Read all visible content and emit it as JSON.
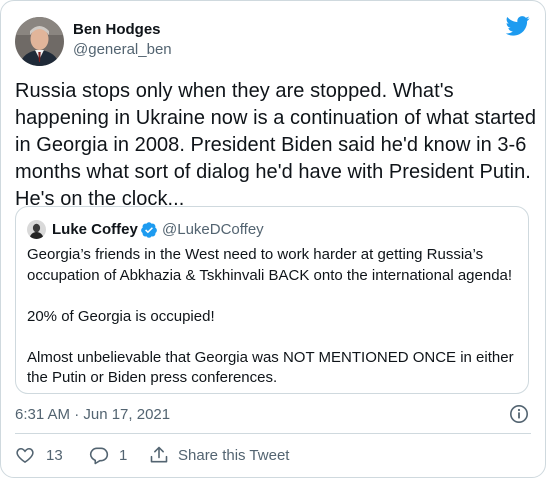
{
  "author": {
    "name": "Ben Hodges",
    "handle": "@general_ben"
  },
  "tweet_text": "Russia stops only when they are stopped.  What's happening in Ukraine now is a continuation of what started in Georgia in 2008. President Biden said he'd know in 3-6 months what sort of dialog he'd have with President Putin.  He's on the clock...",
  "quoted_tweet": {
    "name": "Luke Coffey",
    "handle": "@LukeDCoffey",
    "paragraphs": [
      "Georgia’s friends in the West need to work harder at getting Russia’s occupation of Abkhazia & Tskhinvali BACK onto the international agenda!",
      "20% of Georgia is occupied!",
      "Almost unbelievable that Georgia was NOT MENTIONED ONCE in either the Putin or Biden press conferences."
    ]
  },
  "timestamp": "6:31 AM · Jun 17, 2021",
  "actions": {
    "like_count": "13",
    "reply_count": "1",
    "share_label": "Share this Tweet"
  },
  "colors": {
    "brand": "#1d9bf0",
    "secondary_text": "#536471",
    "border": "#cfd9de"
  },
  "icons": [
    "twitter-bird-icon",
    "verified-badge-icon",
    "info-icon",
    "heart-icon",
    "reply-icon",
    "share-icon"
  ]
}
